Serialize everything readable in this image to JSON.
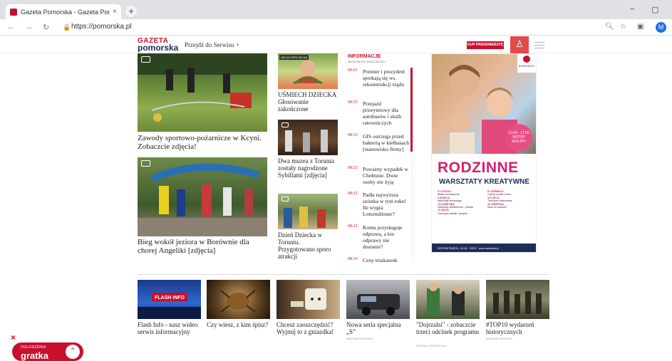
{
  "browser": {
    "tab_title": "Gazeta Pomorska - Gazeta Pomo",
    "tab_close": "×",
    "new_tab": "+",
    "url": "https://pomorska.pl",
    "profile_initial": "M",
    "minimize": "−",
    "restore": "▢",
    "icons": [
      "back-arrow",
      "forward-arrow",
      "reload",
      "lock",
      "zoom",
      "star",
      "extension",
      "profile"
    ]
  },
  "header": {
    "logo_top": "GAZETA",
    "logo_bottom": "pomorska",
    "przejdz": "Przejdź do Serwisu",
    "przejdz_plus": "+",
    "subscribe": "KUP PRENUMERATĘ"
  },
  "main": {
    "article1": "Zawody sportowo-pożarnicze w Kcyni. Zobaczcie zdjęcia!",
    "article2": "Bieg wokół jeziora w Borównie dla chorej Angeliki [zdjęcia]",
    "col2": [
      {
        "tag": "AKCJA SPECJALNA",
        "title": "UŚMIECH DZIECKA Głosowanie zakończone"
      },
      {
        "tag": "",
        "title": "Dwa muzea z Torunia zostały nagrodzone Sybillami [zdjęcia]"
      },
      {
        "tag": "",
        "title": "Dzień Dziecka w Toruniu. Przygotowano sporo atrakcji"
      }
    ]
  },
  "info": {
    "title": "INFORMACJE",
    "subtitle": "NAJNOWSZE WIADOMOŚCI",
    "items": [
      {
        "time": "09:01",
        "text": "Premier i prezydent spotkają się ws. rekonstrukcji rządu"
      },
      {
        "time": "08:55",
        "text": "Przejazd priorytetowy dla autobusów i służb ratowniczych"
      },
      {
        "time": "08:33",
        "text": "GIS ostrzega przed bakterią w kiełbasach [stanowisko firmy]"
      },
      {
        "time": "08:23",
        "text": "Poważny wypadek w Chełmnie. Dwie osoby nie żyją"
      },
      {
        "time": "08:23",
        "text": "Padła najwyższa szóstka w tym roku! Ile wygra Lottomilioner?"
      },
      {
        "time": "08:22",
        "text": "Komu przysługuje odprawa, a kto odprawy nie dostanie?"
      },
      {
        "time": "08:19",
        "text": "Ceny truskawek"
      }
    ]
  },
  "ad": {
    "logo": "BYDGOSZCZ",
    "circle": "12:00 - 17:00 WSTĘP WOLNY!",
    "h1": "RODZINNE",
    "h2": "WARSZTATY KREATYWNE",
    "left_col": [
      {
        "date": "9 LUTEGO",
        "text": "Masło kosmetyczne"
      },
      {
        "date": "9 MARCA",
        "text": "Warsztaty decoupage"
      },
      {
        "date": "13 KWIETNIA",
        "text": "Dekoracje wielkanocne - pisanki"
      },
      {
        "date": "11 MAJA",
        "text": "Tworzymy kwiatki i pacynki"
      }
    ],
    "right_col": [
      {
        "date": "8 CZERWCA",
        "text": "Lepimy mydła i różne"
      },
      {
        "date": "13 LIPCA",
        "text": "Tworzymy instrumenty"
      },
      {
        "date": "10 SIERPNIA",
        "text": "Nerki ze wstążek"
      }
    ],
    "footer": "PATRONI ŚWIĘTA · KLUB · CIESZ · www.zachodnia.pl"
  },
  "bottom": [
    {
      "caption": "Flash Info - nasz wideo serwis informacyjny",
      "source": ""
    },
    {
      "caption": "Czy wiesz, z kim śpisz?",
      "source": ""
    },
    {
      "caption": "Chcesz zaoszczędzić? Wyjmij to z gniazdka!",
      "source": ""
    },
    {
      "caption": "Nowa seria specjalna „S”",
      "source": "MATERIAŁ PARTNERA"
    },
    {
      "caption": "\"Dojrzalsi\" - zobaczcie trzeci odcinek programu",
      "source": "MATERIAŁ PROMOCYJNY"
    },
    {
      "caption": "#TOP10 wydarzeń historycznych",
      "source": "MATERIAŁ PARTNERA"
    }
  ],
  "ogloszenia": {
    "close": "×",
    "label": "OGŁOSZENIA",
    "brand": "gratka",
    "chevron": "⌃"
  }
}
